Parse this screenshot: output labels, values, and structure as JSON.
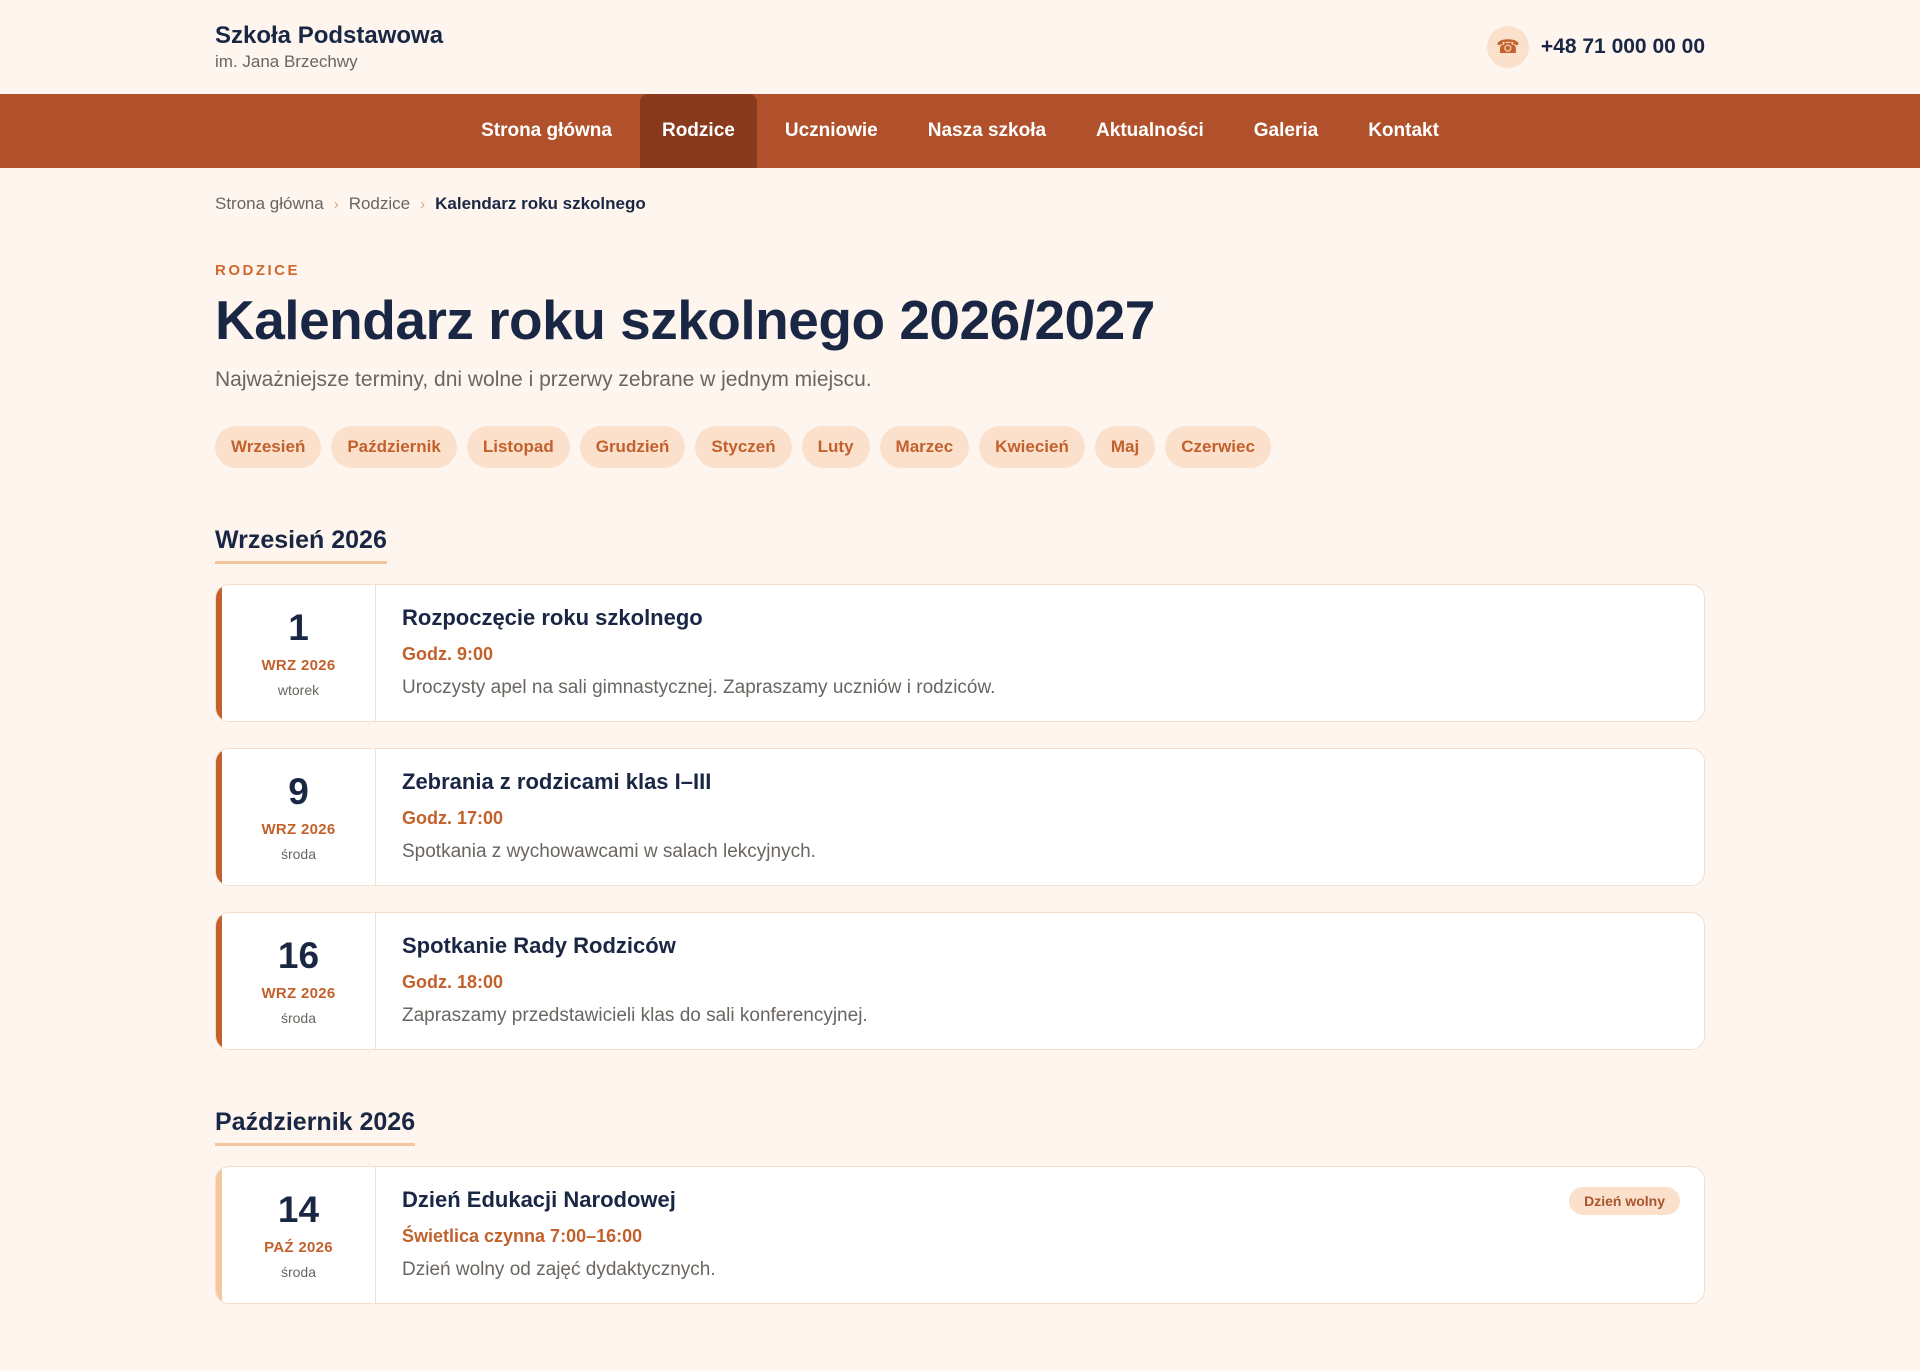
{
  "brand": {
    "name": "Szkoła Podstawowa",
    "sub": "im. Jana Brzechwy"
  },
  "phone": {
    "icon": "phone-icon",
    "number": "+48 71 000 00 00"
  },
  "nav": [
    {
      "label": "Strona główna"
    },
    {
      "label": "Rodzice",
      "active": true
    },
    {
      "label": "Uczniowie"
    },
    {
      "label": "Nasza szkoła"
    },
    {
      "label": "Aktualności"
    },
    {
      "label": "Galeria"
    },
    {
      "label": "Kontakt"
    }
  ],
  "breadcrumb": [
    "Strona główna",
    "Rodzice",
    "Kalendarz roku szkolnego"
  ],
  "eyebrow": "RODZICE",
  "title": "Kalendarz roku szkolnego 2026/2027",
  "lead": "Najważniejsze terminy, dni wolne i przerwy zebrane w jednym miejscu.",
  "months": [
    "Wrzesień",
    "Październik",
    "Listopad",
    "Grudzień",
    "Styczeń",
    "Luty",
    "Marzec",
    "Kwiecień",
    "Maj",
    "Czerwiec"
  ],
  "sections": [
    {
      "title": "Wrzesień 2026",
      "events": [
        {
          "day": "1",
          "mon": "WRZ 2026",
          "wd": "wtorek",
          "title": "Rozpoczęcie roku szkolnego",
          "time": "Godz. 9:00",
          "desc": "Uroczysty apel na sali gimnastycznej. Zapraszamy uczniów i rodziców."
        },
        {
          "day": "9",
          "mon": "WRZ 2026",
          "wd": "środa",
          "title": "Zebrania z rodzicami klas I–III",
          "time": "Godz. 17:00",
          "desc": "Spotkania z wychowawcami w salach lekcyjnych."
        },
        {
          "day": "16",
          "mon": "WRZ 2026",
          "wd": "środa",
          "title": "Spotkanie Rady Rodziców",
          "time": "Godz. 18:00",
          "desc": "Zapraszamy przedstawicieli klas do sali konferencyjnej."
        }
      ]
    },
    {
      "title": "Październik 2026",
      "events": [
        {
          "day": "14",
          "mon": "PAŹ 2026",
          "wd": "środa",
          "title": "Dzień Edukacji Narodowej",
          "time": "Świetlica czynna 7:00–16:00",
          "desc": "Dzień wolny od zajęć dydaktycznych.",
          "badge": "Dzień wolny"
        }
      ]
    }
  ],
  "colors": {
    "accent": "#b1512c",
    "accent_dark": "#8a3a1c",
    "chip_bg": "#fbe0cc",
    "page_bg": "#fdf5ee",
    "heading": "#1a2744"
  }
}
